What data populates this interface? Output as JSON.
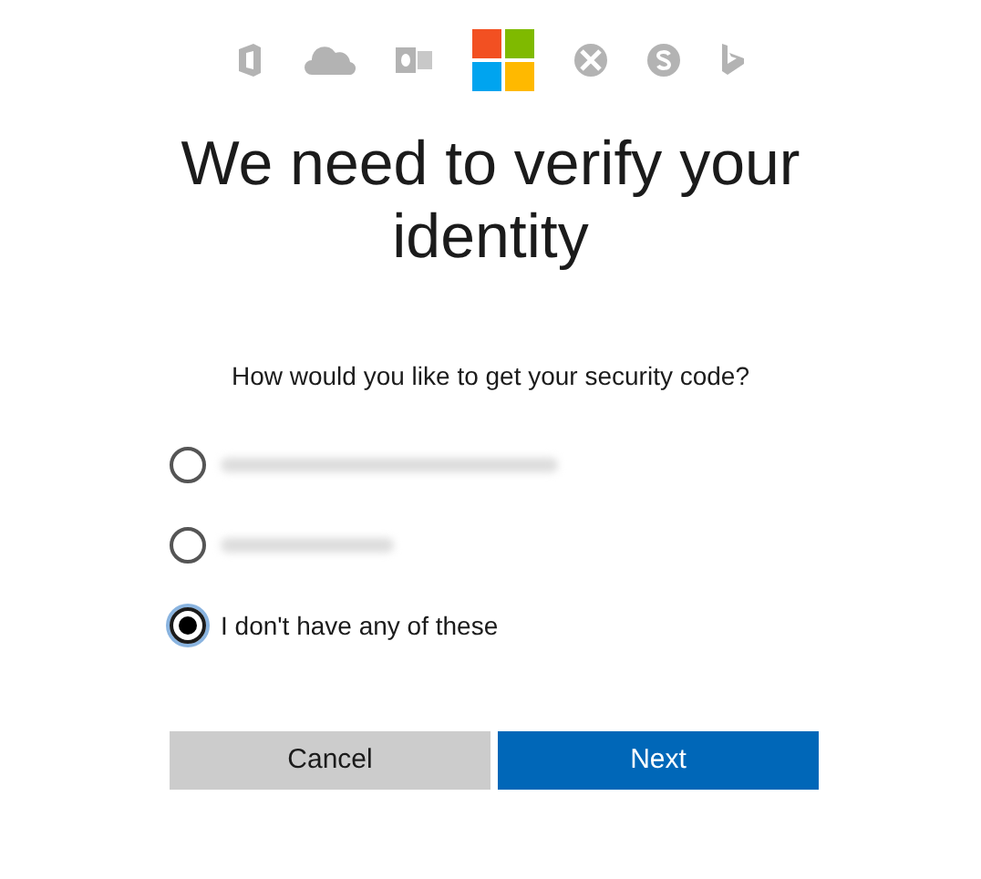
{
  "title": "We need to verify your identity",
  "question": "How would you like to get your security code?",
  "options": [
    {
      "kind": "redacted",
      "selected": false
    },
    {
      "kind": "redacted",
      "selected": false
    },
    {
      "kind": "text",
      "label": "I don't have any of these",
      "selected": true
    }
  ],
  "buttons": [
    {
      "label": "Cancel",
      "kind": "secondary"
    },
    {
      "label": "Next",
      "kind": "primary"
    }
  ]
}
